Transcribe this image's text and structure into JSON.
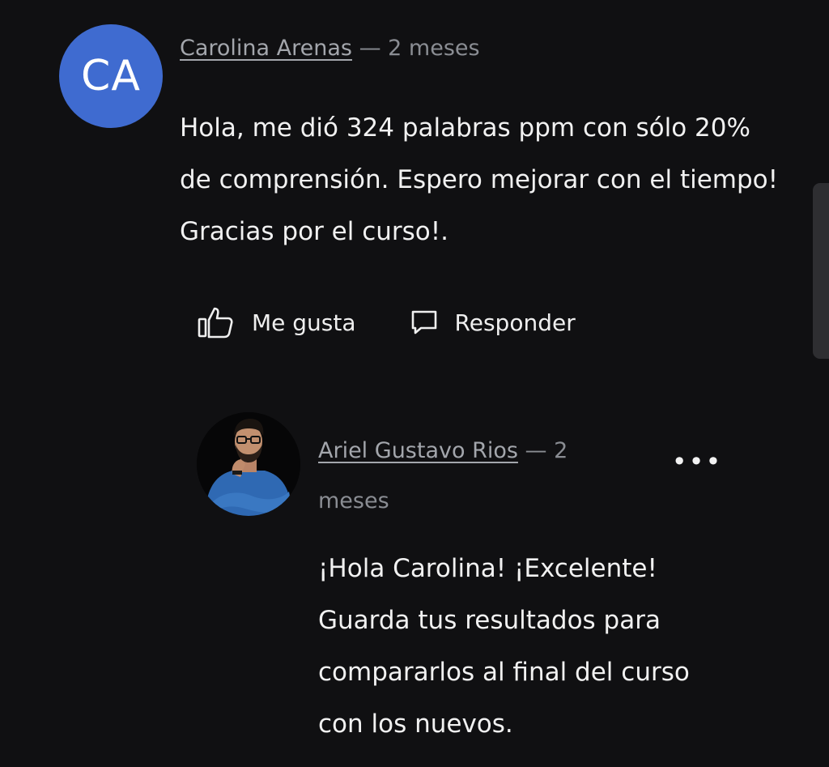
{
  "comment": {
    "avatar_initials": "CA",
    "author": "Carolina Arenas",
    "separator": "— 2 meses",
    "text": "Hola, me dió 324 palabras ppm con sólo 20% de comprensión. Espero mejorar con el tiempo! Gracias por el curso!.",
    "avatar_color": "#3f6bd0"
  },
  "actions": {
    "like_label": "Me gusta",
    "like_icon": "thumbs-up-icon",
    "reply_label": "Responder",
    "reply_icon": "speech-bubble-icon"
  },
  "reply": {
    "author": "Ariel Gustavo Rios",
    "separator": "— 2 meses",
    "more_label": "•••",
    "text": "¡Hola Carolina! ¡Excelente! Guarda tus resultados para compararlos al final del curso con los nuevos."
  }
}
